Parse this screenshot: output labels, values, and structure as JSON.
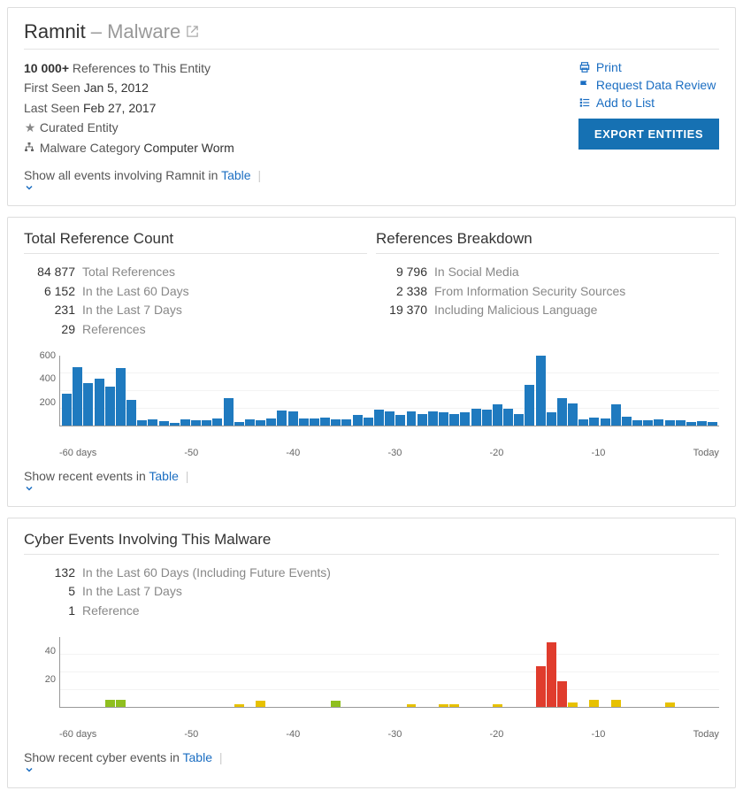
{
  "header": {
    "name": "Ramnit",
    "type_prefix": "–",
    "type": "Malware"
  },
  "meta": {
    "refs_count": "10 000+",
    "refs_label": "References to This Entity",
    "first_seen_label": "First Seen",
    "first_seen": "Jan 5, 2012",
    "last_seen_label": "Last Seen",
    "last_seen": "Feb 27, 2017",
    "curated": "Curated Entity",
    "category_label": "Malware Category",
    "category": "Computer Worm"
  },
  "actions": {
    "print": "Print",
    "review": "Request Data Review",
    "addlist": "Add to List",
    "export": "EXPORT ENTITIES"
  },
  "show_events": {
    "prefix": "Show all events involving Ramnit in",
    "table": "Table"
  },
  "ref_panel": {
    "left_title": "Total Reference Count",
    "right_title": "References Breakdown",
    "left_stats": [
      {
        "n": "84 877",
        "l": "Total References"
      },
      {
        "n": "6 152",
        "l": "In the Last 60 Days"
      },
      {
        "n": "231",
        "l": "In the Last 7 Days"
      },
      {
        "n": "29",
        "l": "References"
      }
    ],
    "right_stats": [
      {
        "n": "9 796",
        "l": "In Social Media"
      },
      {
        "n": "2 338",
        "l": "From Information Security Sources"
      },
      {
        "n": "19 370",
        "l": "Including Malicious Language"
      }
    ],
    "show_prefix": "Show recent events in",
    "show_table": "Table"
  },
  "cyber_panel": {
    "title": "Cyber Events Involving This Malware",
    "stats": [
      {
        "n": "132",
        "l": "In the Last 60 Days (Including Future Events)"
      },
      {
        "n": "5",
        "l": "In the Last 7 Days"
      },
      {
        "n": "1",
        "l": "Reference"
      }
    ],
    "show_prefix": "Show recent cyber events in",
    "show_table": "Table"
  },
  "chart_data": [
    {
      "id": "ref_chart",
      "type": "bar",
      "title": "Total Reference Count",
      "ylabel": "",
      "xlabel": "",
      "ylim": [
        0,
        600
      ],
      "yticks": [
        200,
        400,
        600
      ],
      "x_ticks": [
        "-60 days",
        "-50",
        "-40",
        "-30",
        "-20",
        "-10",
        "Today"
      ],
      "series": [
        {
          "name": "references",
          "color": "#1f7abf",
          "values": [
            270,
            500,
            360,
            400,
            330,
            495,
            220,
            45,
            50,
            35,
            20,
            50,
            45,
            40,
            55,
            230,
            30,
            50,
            40,
            60,
            130,
            120,
            55,
            60,
            70,
            50,
            50,
            90,
            70,
            135,
            120,
            90,
            120,
            100,
            120,
            110,
            100,
            115,
            140,
            135,
            180,
            140,
            100,
            350,
            600,
            110,
            230,
            185,
            50,
            70,
            55,
            180,
            75,
            45,
            40,
            50,
            45,
            40,
            30,
            35,
            30
          ]
        }
      ]
    },
    {
      "id": "cyber_chart",
      "type": "bar",
      "title": "Cyber Events Involving This Malware",
      "ylabel": "",
      "xlabel": "",
      "ylim": [
        0,
        50
      ],
      "yticks": [
        20,
        40
      ],
      "x_ticks": [
        "-60 days",
        "-50",
        "-40",
        "-30",
        "-20",
        "-10",
        "Today"
      ],
      "series": [
        {
          "name": "events",
          "values": [
            0,
            0,
            0,
            0,
            5,
            5,
            0,
            0,
            0,
            0,
            0,
            0,
            0,
            0,
            0,
            0,
            2,
            0,
            4,
            0,
            0,
            0,
            0,
            0,
            0,
            4,
            0,
            0,
            0,
            0,
            0,
            0,
            2,
            0,
            0,
            2,
            2,
            0,
            0,
            0,
            2,
            0,
            0,
            0,
            29,
            46,
            18,
            3,
            0,
            5,
            0,
            5,
            0,
            0,
            0,
            0,
            3,
            0,
            0,
            0,
            0
          ],
          "colors": [
            "none",
            "none",
            "none",
            "none",
            "green",
            "green",
            "none",
            "none",
            "none",
            "none",
            "none",
            "none",
            "none",
            "none",
            "none",
            "none",
            "yellow",
            "none",
            "yellow",
            "none",
            "none",
            "none",
            "none",
            "none",
            "none",
            "green",
            "none",
            "none",
            "none",
            "none",
            "none",
            "none",
            "yellow",
            "none",
            "none",
            "yellow",
            "yellow",
            "none",
            "none",
            "none",
            "yellow",
            "none",
            "none",
            "none",
            "red",
            "red",
            "red",
            "yellow",
            "none",
            "yellow",
            "none",
            "yellow",
            "none",
            "none",
            "none",
            "none",
            "yellow",
            "none",
            "none",
            "none",
            "none"
          ]
        }
      ]
    }
  ]
}
